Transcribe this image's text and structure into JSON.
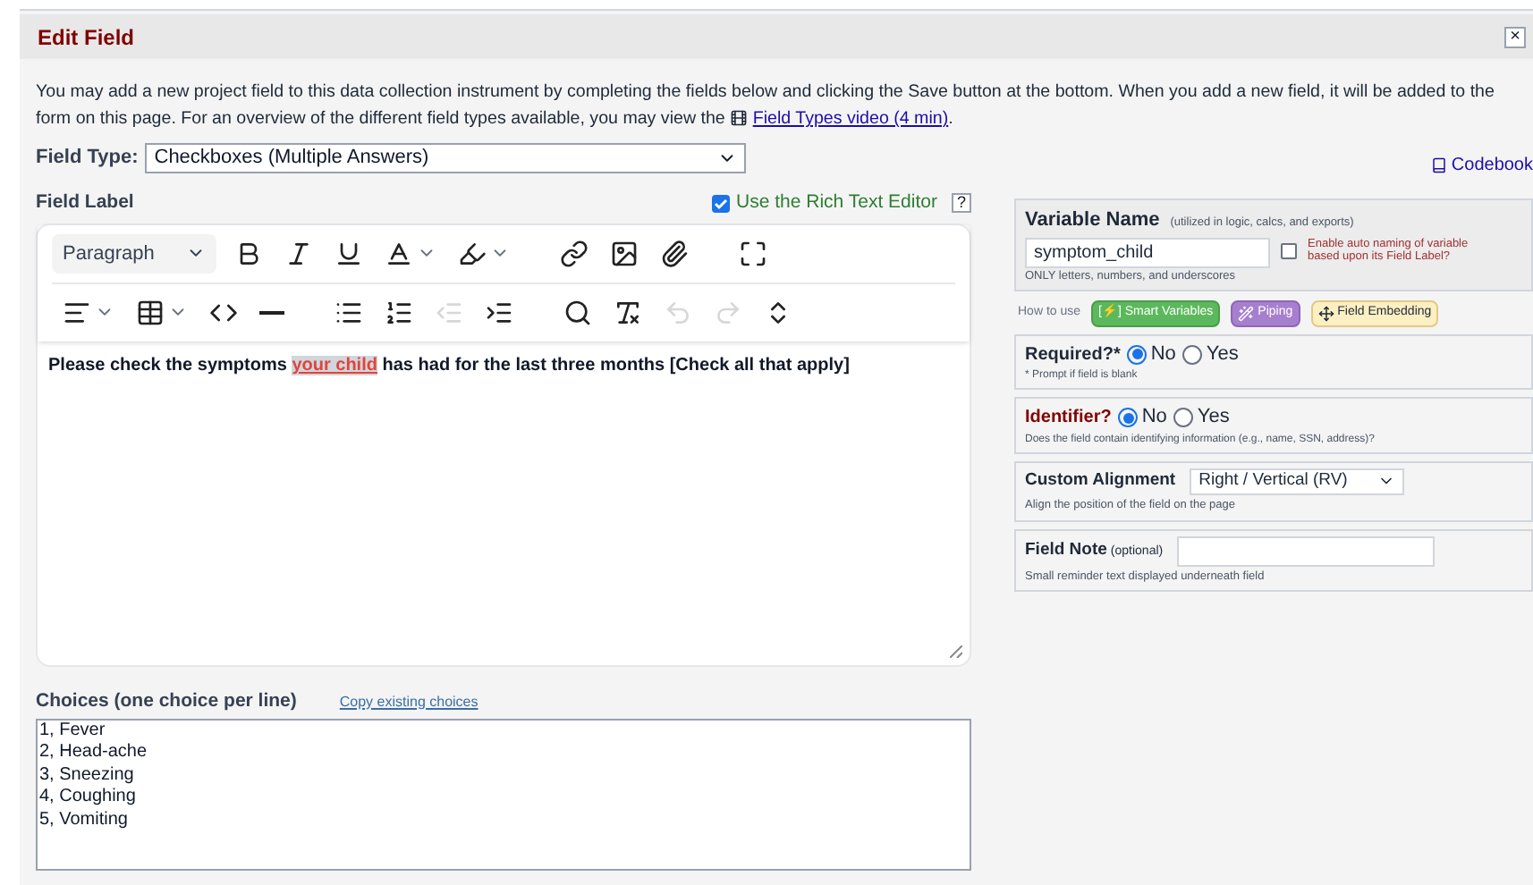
{
  "panel": {
    "title": "Edit Field",
    "close": "×"
  },
  "intro": {
    "text": "You may add a new project field to this data collection instrument by completing the fields below and clicking the Save button at the bottom. When you add a new field, it will be added to the form on this page. For an overview of the different field types available, you may view the",
    "link": "Field Types video (4 min)",
    "end": "."
  },
  "field_type": {
    "label": "Field Type:",
    "value": "Checkboxes (Multiple Answers)"
  },
  "codebook": "Codebook",
  "field_label": {
    "label": "Field Label",
    "rte_label": "Use the Rich Text Editor",
    "rte_checked": true,
    "help": "?"
  },
  "toolbar": {
    "block_format": "Paragraph",
    "rows": [
      [
        [
          {
            "kind": "bold",
            "disabled": false
          },
          {
            "kind": "italic",
            "disabled": false
          },
          {
            "kind": "underline",
            "disabled": false
          },
          {
            "kind": "text-color",
            "disabled": false
          },
          {
            "kind": "highlight",
            "disabled": false
          }
        ],
        [
          {
            "kind": "link",
            "disabled": false
          },
          {
            "kind": "image",
            "disabled": false
          },
          {
            "kind": "attach",
            "disabled": false
          }
        ],
        [
          {
            "kind": "fullscreen",
            "disabled": false
          }
        ]
      ],
      [
        [
          {
            "kind": "align",
            "disabled": false
          },
          {
            "kind": "table",
            "disabled": false
          },
          {
            "kind": "code",
            "disabled": false
          },
          {
            "kind": "rule",
            "disabled": false
          }
        ],
        [
          {
            "kind": "bullets",
            "disabled": false
          },
          {
            "kind": "numbers",
            "disabled": false
          },
          {
            "kind": "outdent",
            "disabled": true
          },
          {
            "kind": "indent",
            "disabled": false
          }
        ],
        [
          {
            "kind": "search",
            "disabled": false
          },
          {
            "kind": "clear",
            "disabled": false
          },
          {
            "kind": "undo",
            "disabled": true
          },
          {
            "kind": "redo",
            "disabled": true
          },
          {
            "kind": "source",
            "disabled": false
          }
        ]
      ]
    ]
  },
  "editor": {
    "before": "Please check the symptoms ",
    "piped": "your child",
    "after": " has had for the last three months [Check all that apply]"
  },
  "choices": {
    "label": "Choices (one choice per line)",
    "copy_link": "Copy existing choices",
    "lines": [
      "1, Fever",
      "2, Head-ache",
      "3, Sneezing",
      "4, Coughing",
      "5, Vomiting"
    ]
  },
  "variable": {
    "label": "Variable Name",
    "hint": "(utilized in logic, calcs, and exports)",
    "value": "symptom_child",
    "auto_label": "Enable auto naming of variable based upon its Field Label?",
    "auto_checked": false,
    "note": "ONLY letters, numbers, and underscores"
  },
  "how_to": {
    "label": "How to use",
    "buttons": [
      {
        "kind": "smart",
        "label": "[⚡] Smart Variables"
      },
      {
        "kind": "piping",
        "label": "Piping"
      },
      {
        "kind": "embed",
        "label": "Field Embedding"
      }
    ]
  },
  "required": {
    "label": "Required?*",
    "options": [
      {
        "label": "No",
        "selected": true
      },
      {
        "label": "Yes",
        "selected": false
      }
    ],
    "note": "* Prompt if field is blank"
  },
  "identifier": {
    "label": "Identifier?",
    "options": [
      {
        "label": "No",
        "selected": true
      },
      {
        "label": "Yes",
        "selected": false
      }
    ],
    "note": "Does the field contain identifying information (e.g., name, SSN, address)?"
  },
  "alignment": {
    "label": "Custom Alignment",
    "value": "Right / Vertical (RV)",
    "note": "Align the position of the field on the page"
  },
  "field_note": {
    "label": "Field Note",
    "hint": "(optional)",
    "note": "Small reminder text displayed underneath field"
  }
}
